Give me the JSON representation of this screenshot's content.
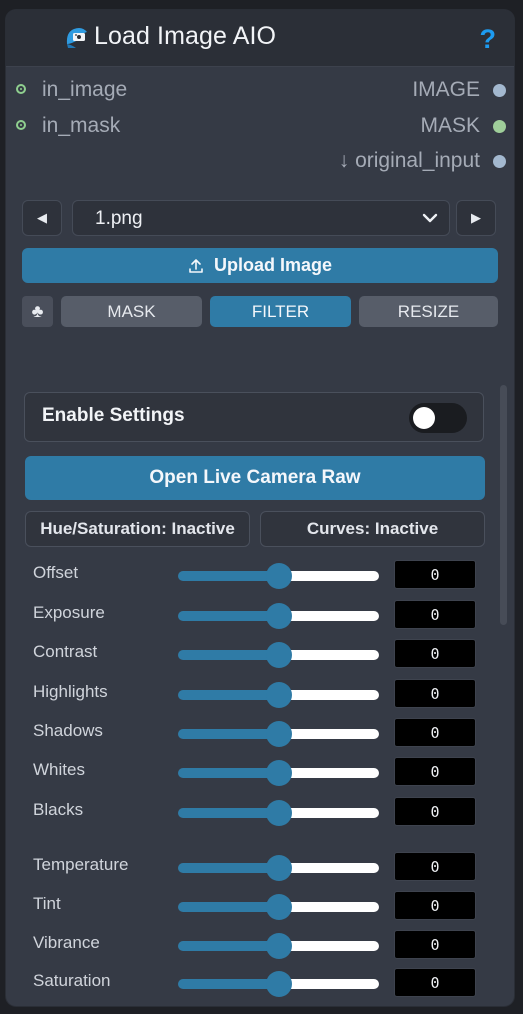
{
  "node": {
    "title": "Load Image AIO",
    "help_label": "?",
    "inputs": [
      "in_image",
      "in_mask"
    ],
    "outputs": [
      {
        "label": "IMAGE",
        "color": "#a3b8cf"
      },
      {
        "label": "MASK",
        "color": "#9fce9a"
      },
      {
        "label": "↓ original_input",
        "color": "#a3b8cf"
      }
    ]
  },
  "file": {
    "selected": "1.png"
  },
  "upload_label": "Upload Image",
  "tabs": [
    {
      "label": "MASK",
      "active": false
    },
    {
      "label": "FILTER",
      "active": true
    },
    {
      "label": "RESIZE",
      "active": false
    }
  ],
  "settings": {
    "enable_label": "Enable Settings",
    "enabled": false,
    "camera_raw_label": "Open Live Camera Raw",
    "hue_status": "Hue/Saturation: Inactive",
    "curves_status": "Curves: Inactive"
  },
  "sliders": [
    {
      "name": "Offset",
      "value": "0",
      "level": 0.5
    },
    {
      "name": "Exposure",
      "value": "0",
      "level": 0.5
    },
    {
      "name": "Contrast",
      "value": "0",
      "level": 0.5
    },
    {
      "name": "Highlights",
      "value": "0",
      "level": 0.5
    },
    {
      "name": "Shadows",
      "value": "0",
      "level": 0.5
    },
    {
      "name": "Whites",
      "value": "0",
      "level": 0.5
    },
    {
      "name": "Blacks",
      "value": "0",
      "level": 0.5
    },
    {
      "name": "Temperature",
      "value": "0",
      "level": 0.5
    },
    {
      "name": "Tint",
      "value": "0",
      "level": 0.5
    },
    {
      "name": "Vibrance",
      "value": "0",
      "level": 0.5
    },
    {
      "name": "Saturation",
      "value": "0",
      "level": 0.5
    }
  ],
  "colors": {
    "accent": "#2f7ba6",
    "node_bg": "#353a45",
    "help": "#1d9bf0"
  }
}
